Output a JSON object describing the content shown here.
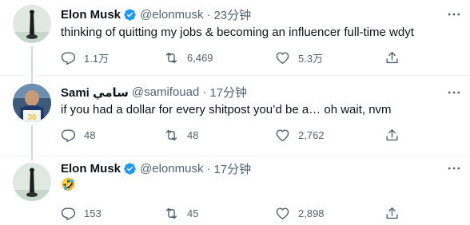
{
  "tweets": [
    {
      "name": "Elon Musk",
      "handle": "@elonmusk",
      "time": "23分钟",
      "text": "thinking of quitting my jobs & becoming an influencer full-time wdyt",
      "replies": "1.1万",
      "retweets": "6,469",
      "likes": "5.3万"
    },
    {
      "name": "Sami سامي",
      "handle": "@samifouad",
      "time": "17分钟",
      "text": "if you had a dollar for every shitpost you’d be a… oh wait, nvm",
      "replies": "48",
      "retweets": "48",
      "likes": "2,762"
    },
    {
      "name": "Elon Musk",
      "handle": "@elonmusk",
      "time": "17分钟",
      "text": "🤣",
      "replies": "153",
      "retweets": "45",
      "likes": "2,898"
    }
  ],
  "separator": "·",
  "colors": {
    "verified": "#1d9bf0",
    "secondary_text": "#536471",
    "thread_line": "#cfd9de"
  },
  "icons": [
    "verified-badge-icon",
    "more-icon",
    "reply-icon",
    "retweet-icon",
    "like-icon",
    "share-icon"
  ]
}
